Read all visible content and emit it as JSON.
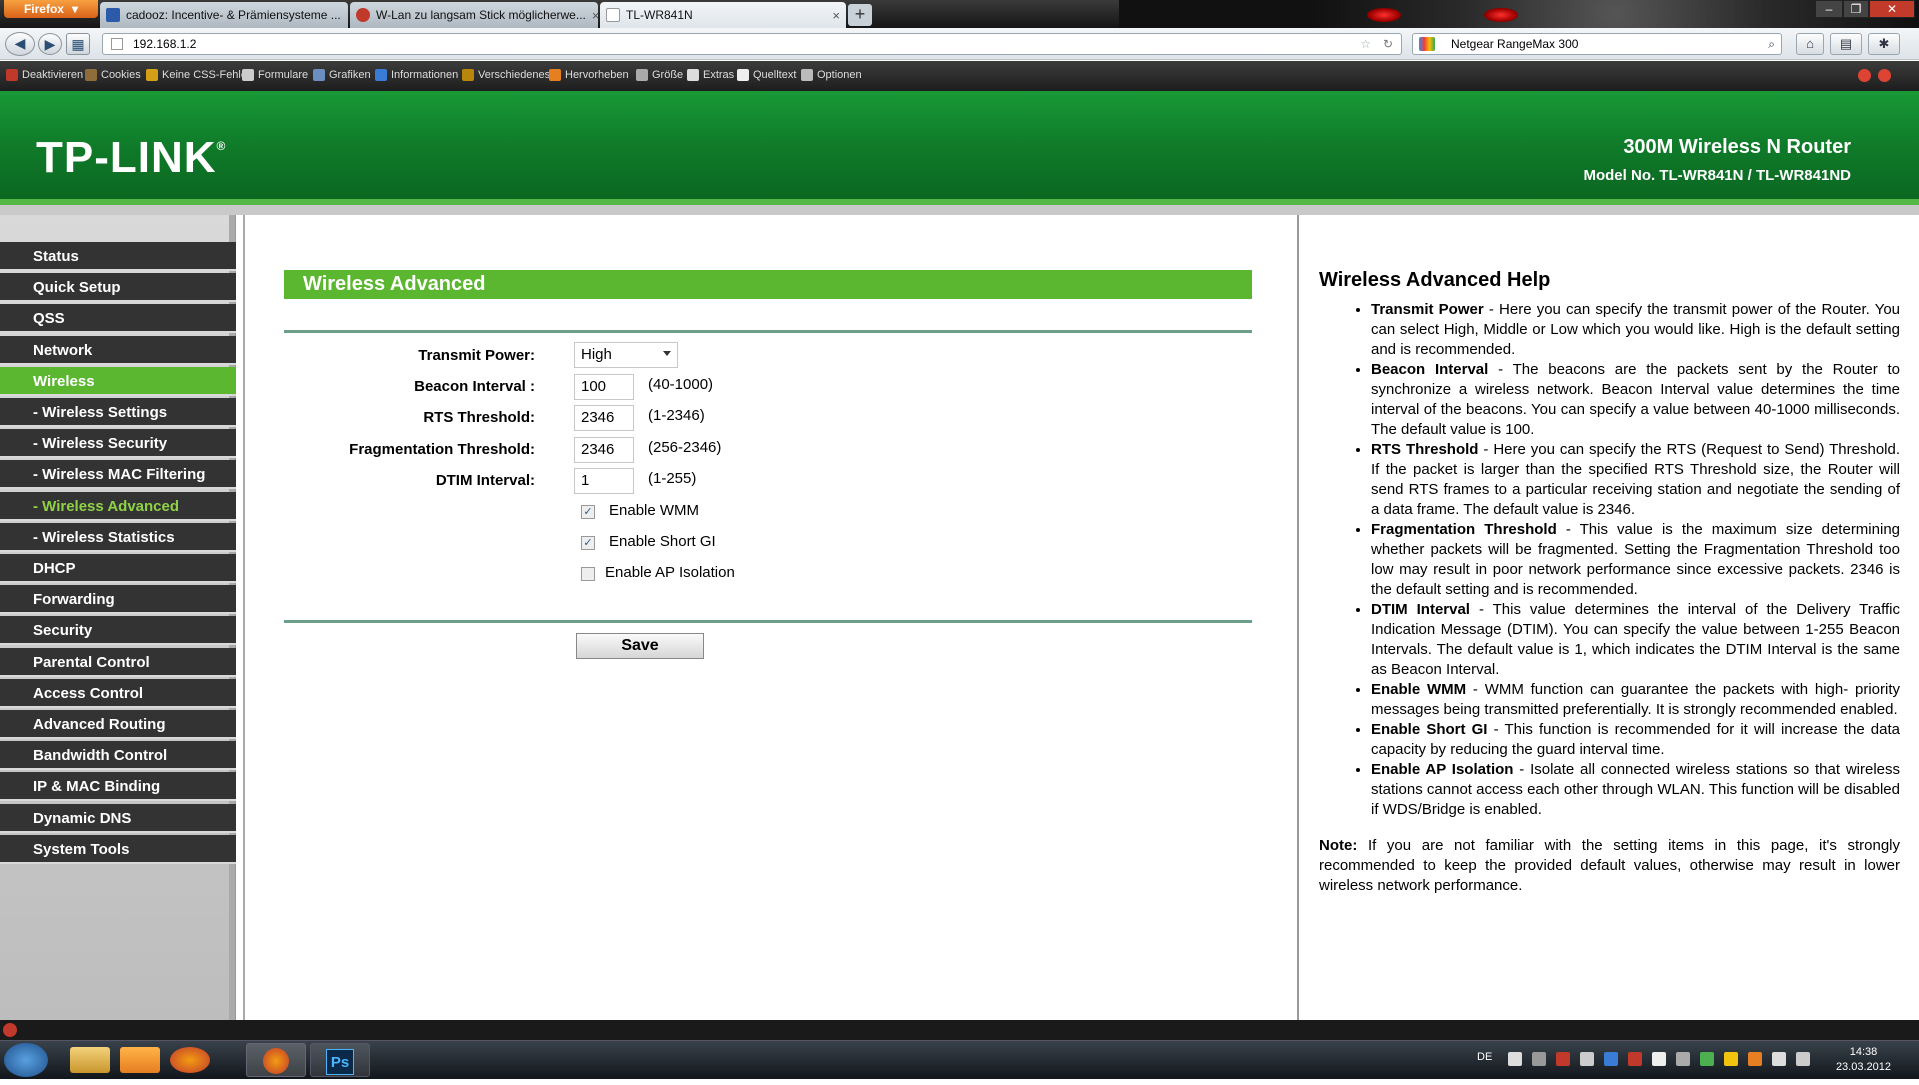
{
  "browser": {
    "menu_label": "Firefox",
    "tabs": [
      {
        "title": "cadooz: Incentive- & Prämiensysteme ..."
      },
      {
        "title": "W-Lan zu langsam Stick möglicherwe..."
      },
      {
        "title": "TL-WR841N"
      }
    ],
    "new_tab": "+",
    "url": "192.168.1.2",
    "search_text": "Netgear RangeMax 300",
    "dev_toolbar": [
      "Deaktivieren",
      "Cookies",
      "Keine CSS-Fehler",
      "Formulare",
      "Grafiken",
      "Informationen",
      "Verschiedenes",
      "Hervorheben",
      "Größe",
      "Extras",
      "Quelltext",
      "Optionen"
    ]
  },
  "header": {
    "logo": "TP-LINK",
    "logo_mark": "®",
    "product": "300M Wireless N Router",
    "model": "Model No. TL-WR841N / TL-WR841ND"
  },
  "sidebar": {
    "items": [
      {
        "label": "Status"
      },
      {
        "label": "Quick Setup"
      },
      {
        "label": "QSS"
      },
      {
        "label": "Network"
      },
      {
        "label": "Wireless"
      },
      {
        "label": "- Wireless Settings"
      },
      {
        "label": "- Wireless Security"
      },
      {
        "label": "- Wireless MAC Filtering"
      },
      {
        "label": "- Wireless Advanced"
      },
      {
        "label": "- Wireless Statistics"
      },
      {
        "label": "DHCP"
      },
      {
        "label": "Forwarding"
      },
      {
        "label": "Security"
      },
      {
        "label": "Parental Control"
      },
      {
        "label": "Access Control"
      },
      {
        "label": "Advanced Routing"
      },
      {
        "label": "Bandwidth Control"
      },
      {
        "label": "IP & MAC Binding"
      },
      {
        "label": "Dynamic DNS"
      },
      {
        "label": "System Tools"
      }
    ]
  },
  "form": {
    "title": "Wireless Advanced",
    "transmit_power": {
      "label": "Transmit Power:",
      "value": "High"
    },
    "beacon_interval": {
      "label": "Beacon Interval :",
      "value": "100",
      "range": "(40-1000)"
    },
    "rts_threshold": {
      "label": "RTS Threshold:",
      "value": "2346",
      "range": "(1-2346)"
    },
    "fragmentation_threshold": {
      "label": "Fragmentation Threshold:",
      "value": "2346",
      "range": "(256-2346)"
    },
    "dtim_interval": {
      "label": "DTIM Interval:",
      "value": "1",
      "range": "(1-255)"
    },
    "enable_wmm": {
      "label": "Enable WMM",
      "checked": true
    },
    "enable_short_gi": {
      "label": "Enable Short GI",
      "checked": true
    },
    "enable_ap_isolation": {
      "label": "Enable AP Isolation",
      "checked": false
    },
    "save_label": "Save"
  },
  "help": {
    "title": "Wireless Advanced Help",
    "items": [
      {
        "term": "Transmit Power",
        "text": " - Here you can specify the transmit power of the Router. You can select High, Middle or Low which you would like. High is the default setting and is recommended."
      },
      {
        "term": "Beacon Interval",
        "text": " - The beacons are the packets sent by the Router to synchronize a wireless network. Beacon Interval value determines the time interval of the beacons. You can specify a value between 40-1000 milliseconds. The default value is 100."
      },
      {
        "term": "RTS Threshold",
        "text": " - Here you can specify the RTS (Request to Send) Threshold. If the packet is larger than the specified RTS Threshold size, the Router will send RTS frames to a particular receiving station and negotiate the sending of a data frame. The default value is 2346."
      },
      {
        "term": "Fragmentation Threshold",
        "text": " - This value is the maximum size determining whether packets will be fragmented. Setting the Fragmentation Threshold too low may result in poor network performance since excessive packets. 2346 is the default setting and is recommended."
      },
      {
        "term": "DTIM Interval",
        "text": " - This value determines the interval of the Delivery Traffic Indication Message (DTIM). You can specify the value between 1-255 Beacon Intervals. The default value is 1, which indicates the DTIM Interval is the same as Beacon Interval."
      },
      {
        "term": "Enable WMM",
        "text": " - WMM function can guarantee the packets with high- priority messages being transmitted preferentially. It is strongly recommended enabled."
      },
      {
        "term": "Enable Short GI",
        "text": " - This function is recommended for it will increase the data capacity by reducing the guard interval time."
      },
      {
        "term": "Enable AP Isolation",
        "text": " - Isolate all connected wireless stations so that wireless stations cannot access each other through WLAN. This function will be disabled if WDS/Bridge is enabled."
      }
    ],
    "note_label": "Note:",
    "note_text": " If you are not familiar with the setting items in this page, it's strongly recommended to keep the provided default values, otherwise may result in lower wireless network performance."
  },
  "taskbar": {
    "ps_label": "Ps",
    "language": "DE",
    "time": "14:38",
    "date": "23.03.2012"
  },
  "colors": {
    "header_green": "#0f7a29",
    "menu_selected": "#5bb730",
    "menu_bg": "#333333",
    "submenu_active_text": "#8fd246"
  }
}
